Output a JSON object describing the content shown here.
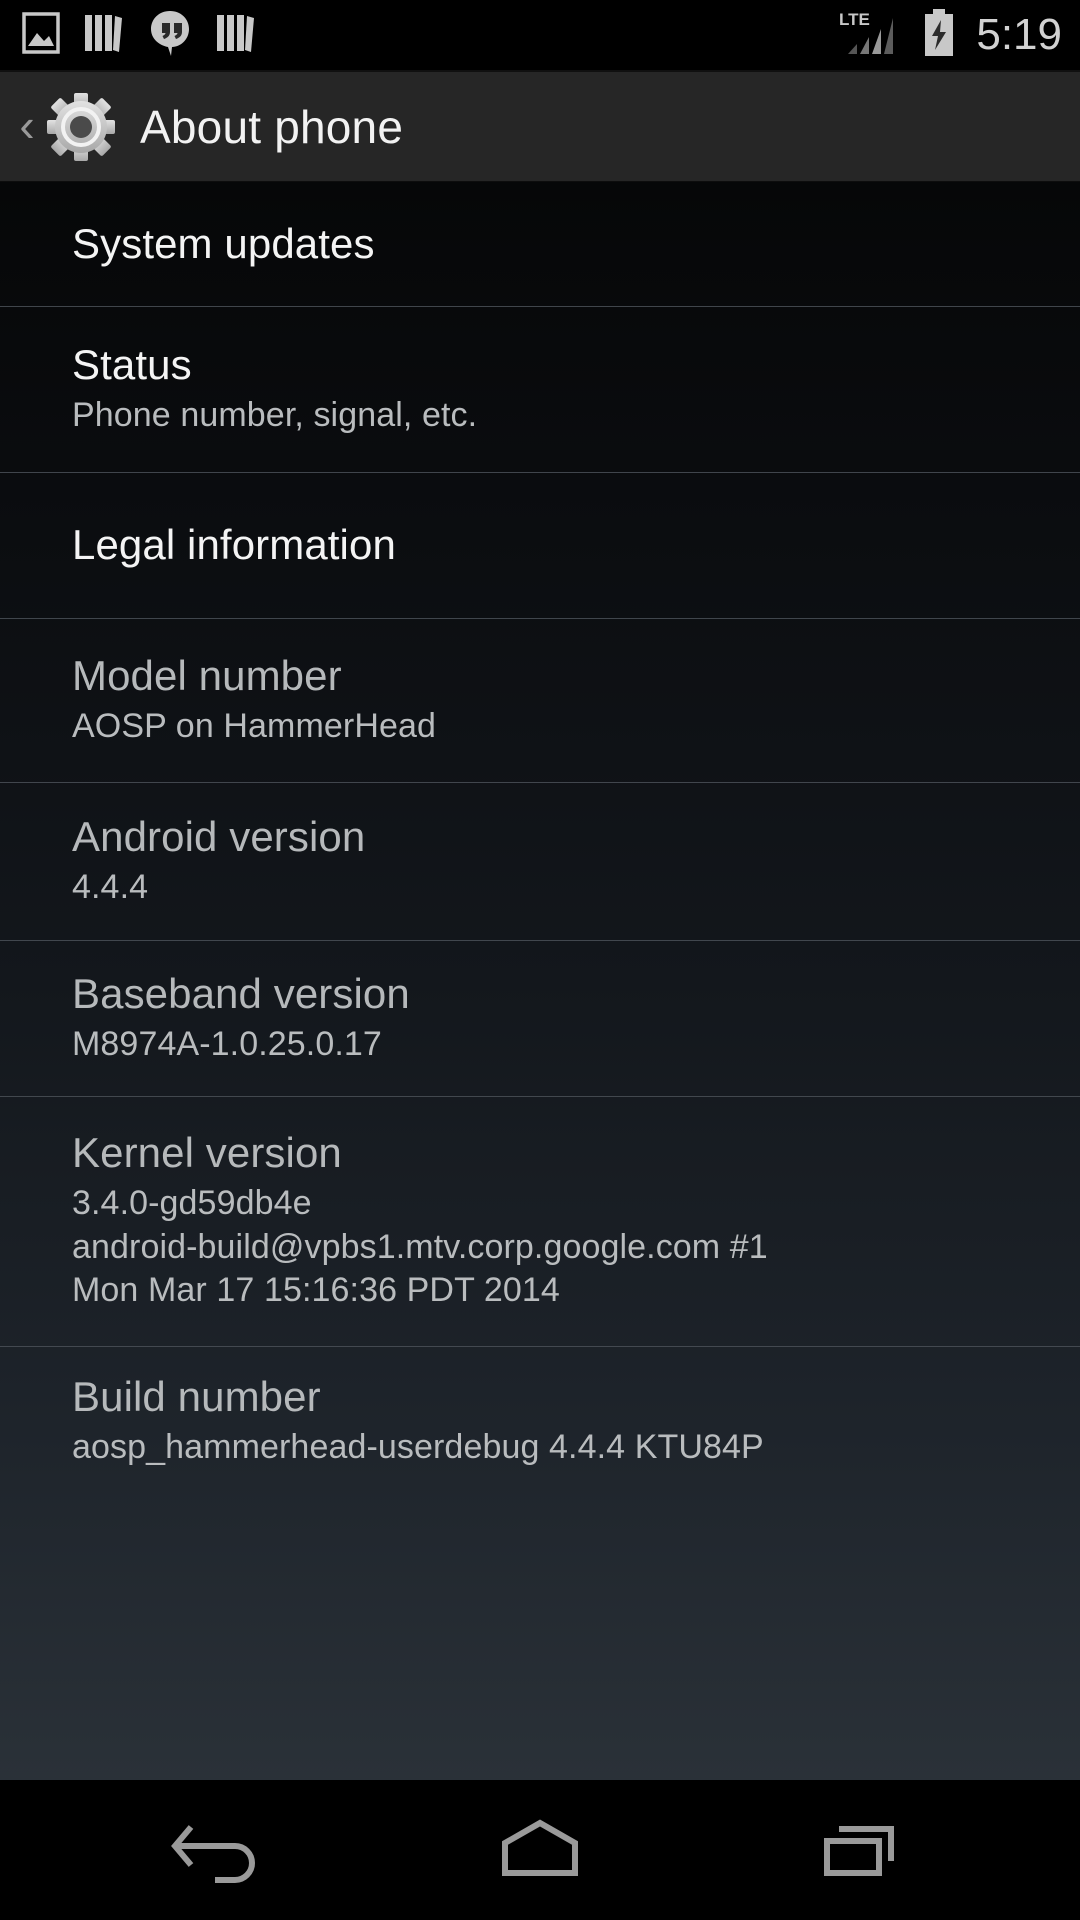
{
  "statusbar": {
    "icons": [
      "photos-icon",
      "books-icon",
      "hangouts-icon",
      "books-icon-2"
    ],
    "network_label": "LTE",
    "signal_icon": "signal-bars-icon",
    "battery_icon": "battery-charging-icon",
    "time": "5:19"
  },
  "actionbar": {
    "back_icon": "back-chevron-icon",
    "back_glyph": "‹",
    "app_icon": "settings-gear-icon",
    "title": "About phone"
  },
  "list": {
    "items": [
      {
        "title": "System updates",
        "subtitle": "",
        "enabled": true
      },
      {
        "title": "Status",
        "subtitle": "Phone number, signal, etc.",
        "enabled": true
      },
      {
        "title": "Legal information",
        "subtitle": "",
        "enabled": true
      },
      {
        "title": "Model number",
        "subtitle": "AOSP on HammerHead",
        "enabled": false
      },
      {
        "title": "Android version",
        "subtitle": "4.4.4",
        "enabled": false
      },
      {
        "title": "Baseband version",
        "subtitle": "M8974A-1.0.25.0.17",
        "enabled": false
      },
      {
        "title": "Kernel version",
        "subtitle_line1": "3.4.0-gd59db4e",
        "subtitle_line2": "android-build@vpbs1.mtv.corp.google.com #1",
        "subtitle_line3": "Mon Mar 17 15:16:36 PDT 2014",
        "enabled": false
      },
      {
        "title": "Build number",
        "subtitle": "aosp_hammerhead-userdebug 4.4.4 KTU84P",
        "enabled": false
      }
    ]
  },
  "navbar": {
    "back": "back-nav-icon",
    "home": "home-nav-icon",
    "recents": "recents-nav-icon"
  },
  "colors": {
    "actionbar_bg": "#262626",
    "list_top": "#060708",
    "list_bottom": "#2a3138",
    "divider": "#4a5057",
    "title_enabled": "#f4f4f4",
    "title_info": "#b6b9bb",
    "subtitle": "#b9bcbe",
    "icon_grey": "#c8c8c8",
    "nav_icon": "#9a9a9a"
  }
}
